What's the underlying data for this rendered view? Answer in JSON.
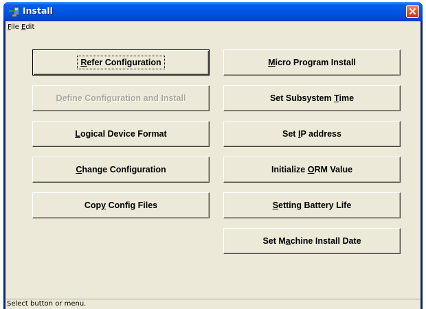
{
  "window": {
    "title": "Install",
    "close_icon": "close-icon",
    "app_icon": "install-app-icon"
  },
  "menu": {
    "items": [
      {
        "label": "File",
        "mnemonic": "F"
      },
      {
        "label": "Edit",
        "mnemonic": "E"
      }
    ]
  },
  "buttons": {
    "left": [
      {
        "pre": "",
        "u": "R",
        "post": "efer Configuration",
        "enabled": true,
        "focused": true
      },
      {
        "pre": "",
        "u": "D",
        "post": "efine Configuration and Install",
        "enabled": false,
        "focused": false
      },
      {
        "pre": "",
        "u": "L",
        "post": "ogical Device Format",
        "enabled": true,
        "focused": false
      },
      {
        "pre": "",
        "u": "C",
        "post": "hange Configuration",
        "enabled": true,
        "focused": false
      },
      {
        "pre": "Cop",
        "u": "y",
        "post": " Config Files",
        "enabled": true,
        "focused": false
      }
    ],
    "right": [
      {
        "pre": "",
        "u": "M",
        "post": "icro Program Install",
        "enabled": true,
        "focused": false
      },
      {
        "pre": "Set Subsystem ",
        "u": "T",
        "post": "ime",
        "enabled": true,
        "focused": false
      },
      {
        "pre": "Set ",
        "u": "I",
        "post": "P address",
        "enabled": true,
        "focused": false
      },
      {
        "pre": "Initialize ",
        "u": "O",
        "post": "RM Value",
        "enabled": true,
        "focused": false
      },
      {
        "pre": "",
        "u": "S",
        "post": "etting Battery Life",
        "enabled": true,
        "focused": false
      },
      {
        "pre": "Set M",
        "u": "a",
        "post": "chine Install Date",
        "enabled": true,
        "focused": false
      }
    ]
  },
  "status": {
    "text": "Select button or menu."
  }
}
